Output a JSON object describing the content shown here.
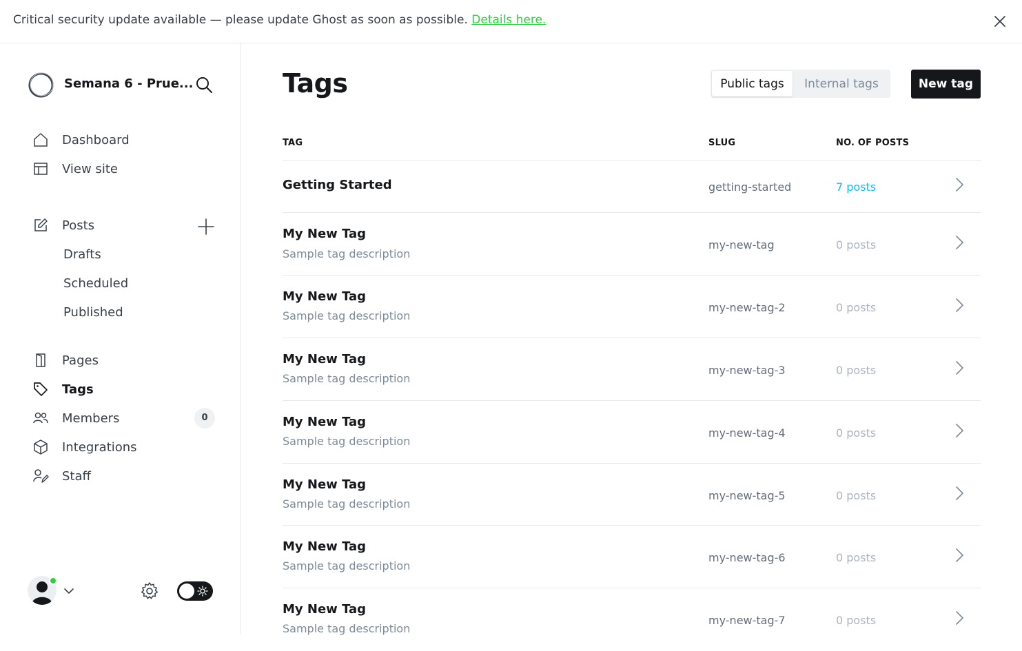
{
  "banner": {
    "message": "Critical security update available — please update Ghost as soon as possible.",
    "link": "Details here."
  },
  "site": {
    "title": "Semana 6 - Prue..."
  },
  "nav": {
    "dashboard": "Dashboard",
    "view_site": "View site",
    "posts": "Posts",
    "drafts": "Drafts",
    "scheduled": "Scheduled",
    "published": "Published",
    "pages": "Pages",
    "tags": "Tags",
    "members": "Members",
    "members_count": "0",
    "integrations": "Integrations",
    "staff": "Staff"
  },
  "header": {
    "title": "Tags",
    "public_tags": "Public tags",
    "internal_tags": "Internal tags",
    "new_tag": "New tag"
  },
  "table": {
    "columns": [
      "TAG",
      "SLUG",
      "NO. OF POSTS"
    ],
    "rows": [
      {
        "name": "Getting Started",
        "description": "",
        "slug": "getting-started",
        "count": "7 posts"
      },
      {
        "name": "My New Tag",
        "description": "Sample tag description",
        "slug": "my-new-tag",
        "count": "0 posts"
      },
      {
        "name": "My New Tag",
        "description": "Sample tag description",
        "slug": "my-new-tag-2",
        "count": "0 posts"
      },
      {
        "name": "My New Tag",
        "description": "Sample tag description",
        "slug": "my-new-tag-3",
        "count": "0 posts"
      },
      {
        "name": "My New Tag",
        "description": "Sample tag description",
        "slug": "my-new-tag-4",
        "count": "0 posts"
      },
      {
        "name": "My New Tag",
        "description": "Sample tag description",
        "slug": "my-new-tag-5",
        "count": "0 posts"
      },
      {
        "name": "My New Tag",
        "description": "Sample tag description",
        "slug": "my-new-tag-6",
        "count": "0 posts"
      },
      {
        "name": "My New Tag",
        "description": "Sample tag description",
        "slug": "my-new-tag-7",
        "count": "0 posts"
      }
    ]
  },
  "colors": {
    "accent_link": "#14b8ff",
    "banner_link": "#30cf43",
    "online": "#30cf43",
    "primary_button": "#15171a"
  },
  "icons": [
    "close-icon",
    "site-logo-icon",
    "search-icon",
    "home-icon",
    "view-site-icon",
    "edit-icon",
    "plus-icon",
    "pages-icon",
    "tag-icon",
    "members-icon",
    "integrations-icon",
    "staff-icon",
    "avatar-icon",
    "chevron-down-icon",
    "gear-icon",
    "sun-icon",
    "chevron-right-icon"
  ]
}
